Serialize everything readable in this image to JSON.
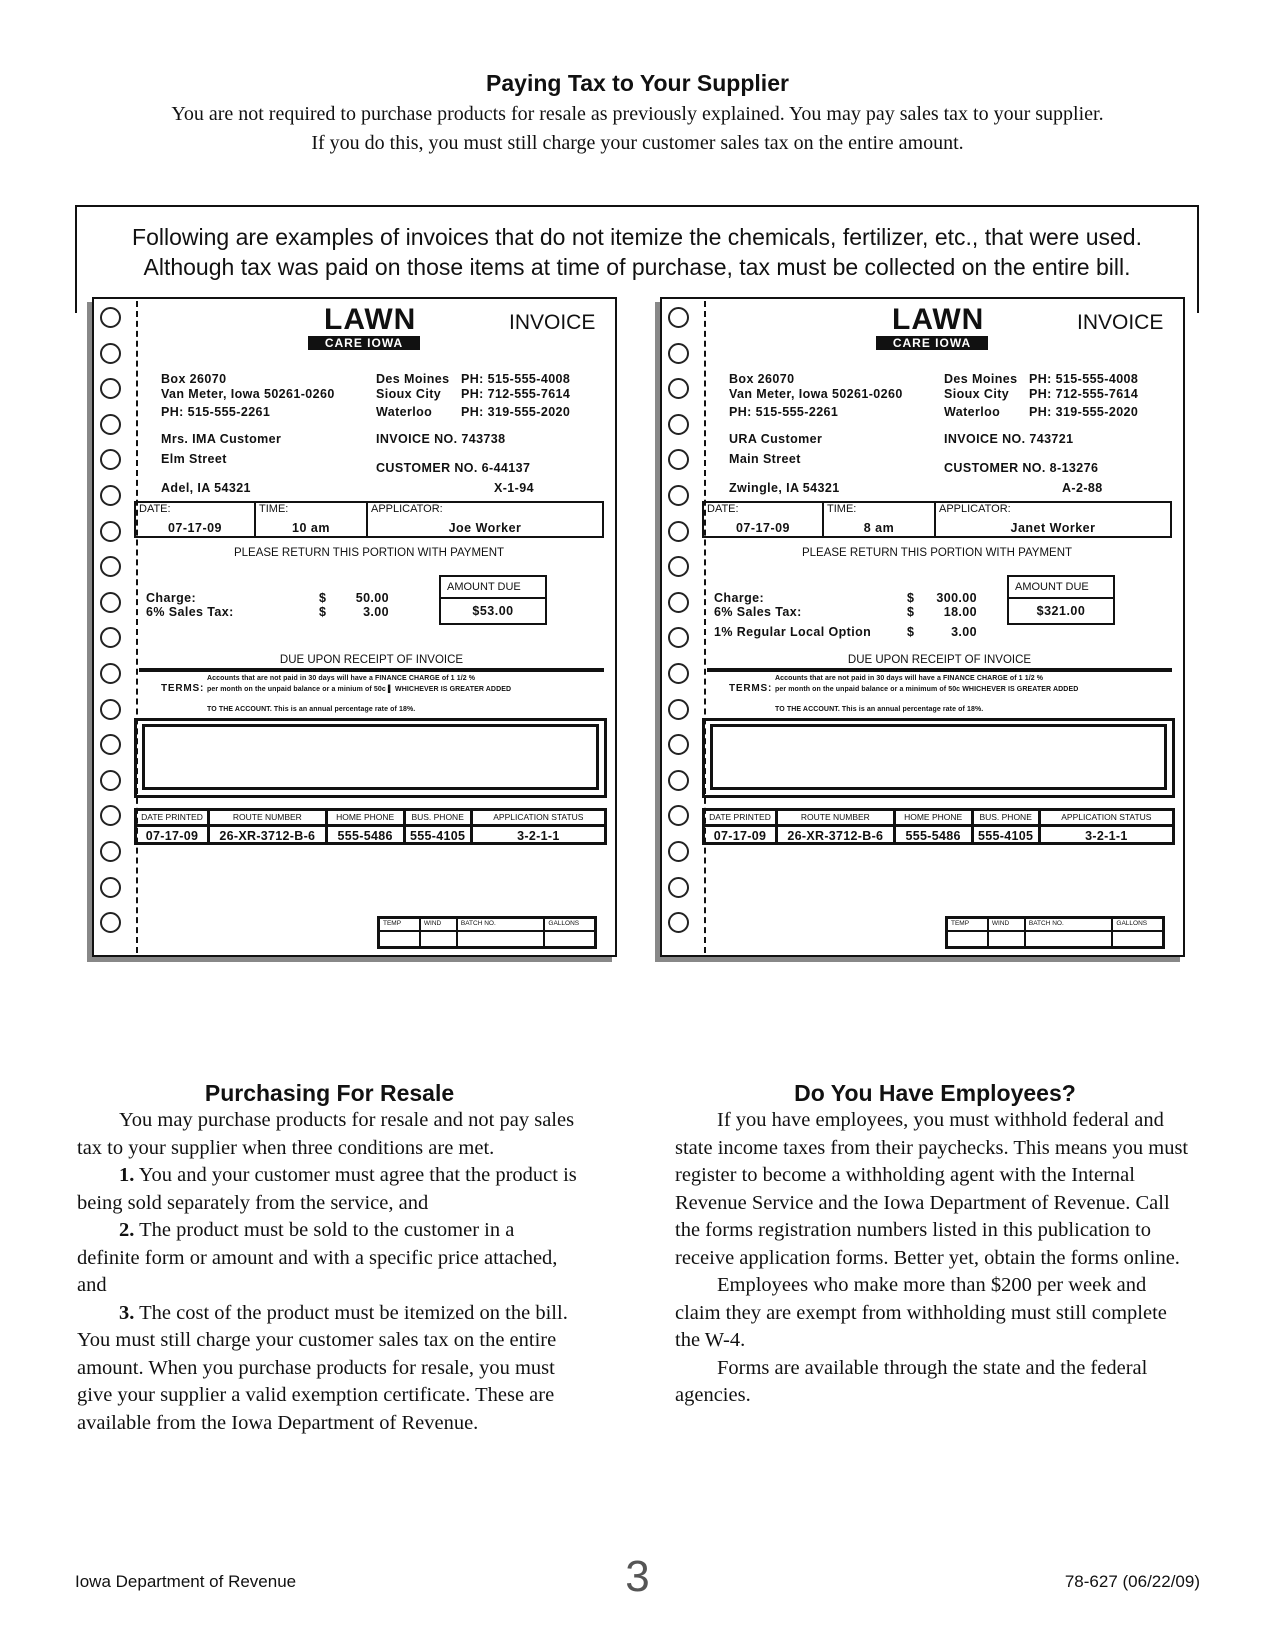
{
  "header": {
    "title": "Paying Tax to Your Supplier",
    "line1": "You are not required to purchase products for resale as previously explained. You may pay sales tax to your supplier.",
    "line2": "If you do this, you must still charge your customer sales tax on the entire amount."
  },
  "callout": {
    "line1": "Following are examples of invoices that do not itemize the chemicals, fertilizer, etc., that were used.",
    "line2": "Although tax was paid on those items at time of purchase, tax must be collected on the entire bill."
  },
  "invoices": [
    {
      "logo": "LAWN",
      "logo_tag": "CARE IOWA",
      "doc_title": "INVOICE",
      "company": {
        "box": "Box 26070",
        "city": "Van Meter, Iowa 50261-0260",
        "phone": "PH: 515-555-2261"
      },
      "branches": [
        {
          "city": "Des Moines",
          "phone": "PH: 515-555-4008"
        },
        {
          "city": "Sioux City",
          "phone": "PH: 712-555-7614"
        },
        {
          "city": "Waterloo",
          "phone": "PH: 319-555-2020"
        }
      ],
      "customer": {
        "name": "Mrs. IMA Customer",
        "street": "Elm Street",
        "city": "Adel, IA 54321"
      },
      "invoice_no": "INVOICE NO. 743738",
      "customer_no": "CUSTOMER NO. 6-44137",
      "account_code": "X-1-94",
      "date_label": "DATE:",
      "date": "07-17-09",
      "time_label": "TIME:",
      "time": "10 am",
      "applicator_label": "APPLICATOR:",
      "applicator": "Joe Worker",
      "return_note": "PLEASE RETURN THIS PORTION WITH PAYMENT",
      "charges": [
        {
          "label": "Charge:",
          "cur": "$",
          "amount": "50.00"
        },
        {
          "label": "6% Sales Tax:",
          "cur": "$",
          "amount": "3.00"
        }
      ],
      "amount_due_label": "AMOUNT DUE",
      "amount_due": "$53.00",
      "due_note": "DUE UPON RECEIPT OF INVOICE",
      "terms_label": "TERMS:",
      "terms1": "Accounts that are not paid in 30 days will have a FINANCE CHARGE of 1 1/2 %",
      "terms2": "per month on the unpaid balance or a minium of 50c ▌ WHICHEVER IS GREATER ADDED",
      "terms3": "TO THE ACCOUNT. This is an annual percentage rate of 18%.",
      "info_headers": [
        "DATE PRINTED",
        "ROUTE NUMBER",
        "HOME PHONE",
        "BUS. PHONE",
        "APPLICATION STATUS"
      ],
      "info_values": [
        "07-17-09",
        "26-XR-3712-B-6",
        "555-5486",
        "555-4105",
        "3-2-1-1"
      ],
      "batch_headers": [
        "TEMP",
        "WIND",
        "BATCH NO.",
        "GALLONS"
      ]
    },
    {
      "logo": "LAWN",
      "logo_tag": "CARE IOWA",
      "doc_title": "INVOICE",
      "company": {
        "box": "Box 26070",
        "city": "Van Meter, Iowa 50261-0260",
        "phone": "PH: 515-555-2261"
      },
      "branches": [
        {
          "city": "Des Moines",
          "phone": "PH: 515-555-4008"
        },
        {
          "city": "Sioux City",
          "phone": "PH: 712-555-7614"
        },
        {
          "city": "Waterloo",
          "phone": "PH: 319-555-2020"
        }
      ],
      "customer": {
        "name": "URA Customer",
        "street": "Main Street",
        "city": "Zwingle, IA 54321"
      },
      "invoice_no": "INVOICE NO. 743721",
      "customer_no": "CUSTOMER NO. 8-13276",
      "account_code": "A-2-88",
      "date_label": "DATE:",
      "date": "07-17-09",
      "time_label": "TIME:",
      "time": "8 am",
      "applicator_label": "APPLICATOR:",
      "applicator": "Janet Worker",
      "return_note": "PLEASE RETURN THIS PORTION WITH PAYMENT",
      "charges": [
        {
          "label": "Charge:",
          "cur": "$",
          "amount": "300.00"
        },
        {
          "label": "6% Sales Tax:",
          "cur": "$",
          "amount": "18.00"
        },
        {
          "label": "1%   Regular Local Option",
          "cur": "$",
          "amount": "3.00"
        }
      ],
      "amount_due_label": "AMOUNT DUE",
      "amount_due": "$321.00",
      "due_note": "DUE UPON RECEIPT OF INVOICE",
      "terms_label": "TERMS:",
      "terms1": "Accounts that are not paid in 30 days will have a FINANCE CHARGE of 1 1/2 %",
      "terms2": "per month on the unpaid balance or a minimum of 50c WHICHEVER IS GREATER ADDED",
      "terms3": "TO THE ACCOUNT. This is an annual percentage rate of 18%.",
      "info_headers": [
        "DATE PRINTED",
        "ROUTE NUMBER",
        "HOME PHONE",
        "BUS. PHONE",
        "APPLICATION STATUS"
      ],
      "info_values": [
        "07-17-09",
        "26-XR-3712-B-6",
        "555-5486",
        "555-4105",
        "3-2-1-1"
      ],
      "batch_headers": [
        "TEMP",
        "WIND",
        "BATCH NO.",
        "GALLONS"
      ]
    }
  ],
  "resale": {
    "title": "Purchasing For Resale",
    "intro": "You may purchase products for resale and not pay sales tax to your supplier when three conditions are met.",
    "items": [
      {
        "num": "1.",
        "text": " You and your customer must agree that the product is being sold separately from the service, and"
      },
      {
        "num": "2.",
        "text": " The product must be sold to the customer in a definite form or amount and with a specific price attached, and"
      },
      {
        "num": "3.",
        "text": " The cost of the product must be itemized on the bill. You must still charge your customer sales tax on the entire amount. When you purchase products for resale, you must give your supplier a valid exemption certificate. These are available from the Iowa Department of Revenue."
      }
    ]
  },
  "employees": {
    "title": "Do You Have Employees?",
    "paragraphs": [
      "If you have employees, you must withhold federal and state income taxes from their paychecks. This means you must register to become a withholding agent with the Internal Revenue Service and the Iowa Department of Revenue. Call the forms registration numbers listed in this publication to receive application forms. Better yet, obtain the forms online.",
      "Employees who make more than $200 per week and claim they are exempt from withholding must still complete the W-4.",
      "Forms are available through the state and the federal agencies."
    ]
  },
  "footer": {
    "agency": "Iowa Department of Revenue",
    "page": "3",
    "form_id": "78-627 (06/22/09)"
  }
}
